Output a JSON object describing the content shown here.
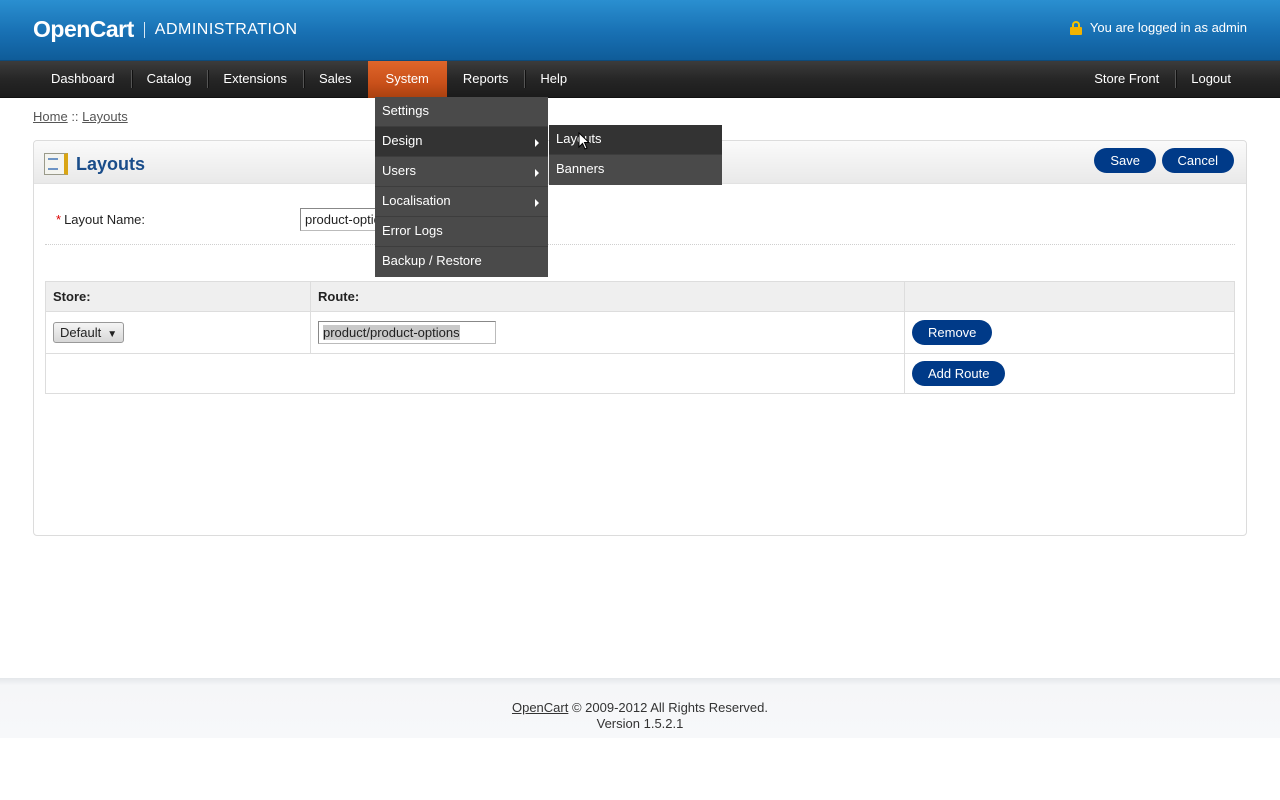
{
  "header": {
    "brand": "OpenCart",
    "subtitle": "ADMINISTRATION",
    "logged_in": "You are logged in as admin"
  },
  "menu": {
    "left": [
      "Dashboard",
      "Catalog",
      "Extensions",
      "Sales",
      "System",
      "Reports",
      "Help"
    ],
    "active": "System",
    "right": [
      "Store Front",
      "Logout"
    ]
  },
  "dropdown": {
    "items": [
      "Settings",
      "Design",
      "Users",
      "Localisation",
      "Error Logs",
      "Backup / Restore"
    ],
    "submenu": [
      "Layouts",
      "Banners"
    ]
  },
  "breadcrumb": {
    "home": "Home",
    "sep": "::",
    "current": "Layouts"
  },
  "box": {
    "title": "Layouts",
    "save_label": "Save",
    "cancel_label": "Cancel",
    "layout_name_label": "Layout Name:",
    "layout_name_value": "product-options"
  },
  "routes": {
    "headers": {
      "store": "Store:",
      "route": "Route:"
    },
    "row": {
      "store": "Default",
      "route": "product/product-options",
      "remove_label": "Remove"
    },
    "add_route_label": "Add Route"
  },
  "footer": {
    "link": "OpenCart",
    "copyright": "© 2009-2012 All Rights Reserved.",
    "version": "Version 1.5.2.1"
  },
  "colors": {
    "header_blue": "#1870b3",
    "active_orange": "#c9501a",
    "button_blue": "#003a88",
    "title_blue": "#1a4d8a"
  }
}
